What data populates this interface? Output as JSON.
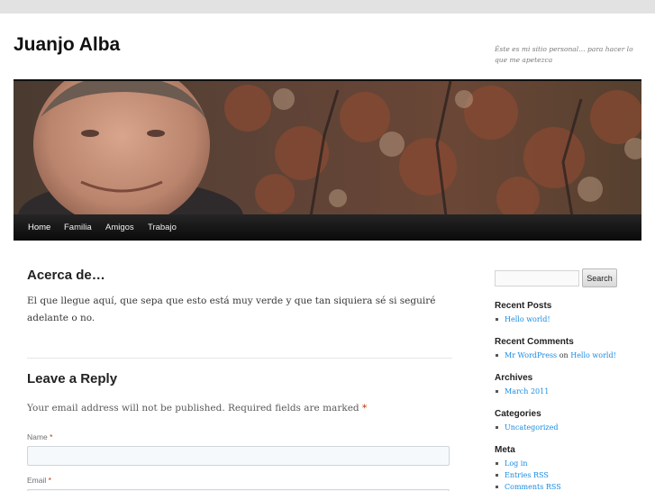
{
  "site": {
    "title": "Juanjo Alba",
    "description": "Éste es mi sitio personal… para hacer lo que me apetezca"
  },
  "nav": {
    "items": [
      "Home",
      "Familia",
      "Amigos",
      "Trabajo"
    ]
  },
  "post": {
    "title": "Acerca de…",
    "content": "El que llegue aquí, que sepa que esto está muy verde y que tan siquiera sé si seguiré adelante o no."
  },
  "reply": {
    "title": "Leave a Reply",
    "notes": "Your email address will not be published. Required fields are marked",
    "required_mark": "*",
    "name_label": "Name",
    "email_label": "Email"
  },
  "sidebar": {
    "search_button": "Search",
    "recent_posts": {
      "title": "Recent Posts",
      "items": [
        "Hello world!"
      ]
    },
    "recent_comments": {
      "title": "Recent Comments",
      "author": "Mr WordPress",
      "on": "on",
      "post": "Hello world!"
    },
    "archives": {
      "title": "Archives",
      "items": [
        "March 2011"
      ]
    },
    "categories": {
      "title": "Categories",
      "items": [
        "Uncategorized"
      ]
    },
    "meta": {
      "title": "Meta",
      "items": [
        "Log in",
        "Entries RSS",
        "Comments RSS"
      ]
    }
  },
  "colors": {
    "link": "#1b8be0",
    "required": "#bd3500",
    "nav_background": "#111111",
    "page_background": "#e2e2e2"
  }
}
